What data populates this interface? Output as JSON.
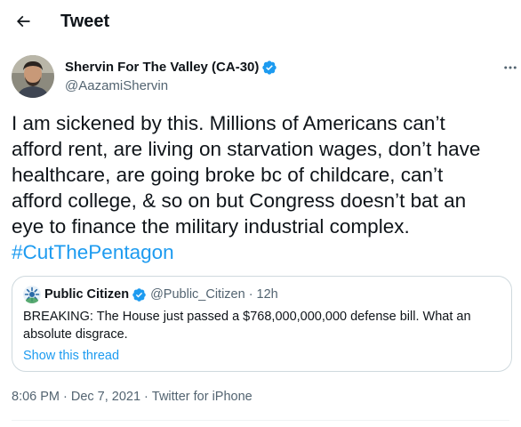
{
  "header": {
    "title": "Tweet",
    "back_icon": "arrow-left-icon"
  },
  "author": {
    "name": "Shervin For The Valley (CA-30)",
    "handle": "@AazamiShervin",
    "verified": true,
    "avatar_icon": "profile-photo"
  },
  "tweet": {
    "text": "I am sickened by this. Millions of Americans can’t\nafford rent, are living on starvation wages, don’t have\nhealthcare, are going broke bc of childcare, can’t\nafford college, & so on but Congress doesn’t bat an\neye to finance the military industrial complex.",
    "hashtag": "#CutThePentagon"
  },
  "quote": {
    "name": "Public Citizen",
    "handle": "@Public_Citizen",
    "separator": "·",
    "time": "12h",
    "verified": true,
    "text": "BREAKING: The House just passed a $768,000,000,000 defense bill. What an absolute disgrace.",
    "thread_link": "Show this thread"
  },
  "meta": {
    "time": "8:06 PM",
    "separator": "·",
    "date": "Dec 7, 2021",
    "source": "Twitter for iPhone"
  },
  "colors": {
    "accent": "#1d9bf0",
    "text": "#0f1419",
    "secondary": "#536471",
    "border": "#cfd9de"
  }
}
